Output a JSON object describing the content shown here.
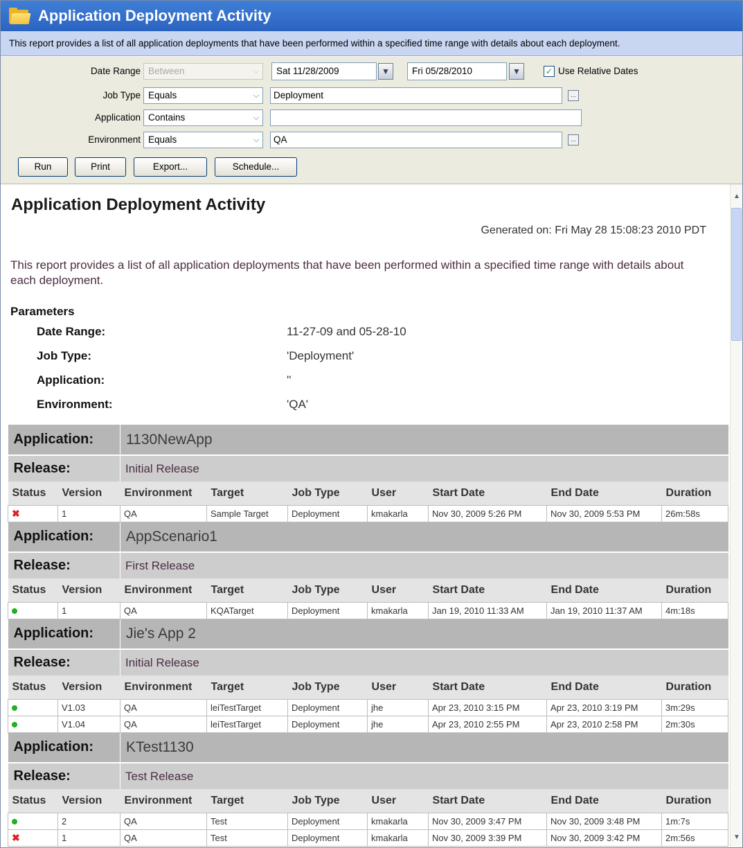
{
  "window": {
    "title": "Application Deployment Activity"
  },
  "description": "This report provides a list of all application deployments that have been performed within a specified time range with details about each deployment.",
  "filters": {
    "date_range": {
      "label": "Date Range",
      "operator": "Between",
      "from": "Sat 11/28/2009",
      "to": "Fri 05/28/2010",
      "use_relative_dates_label": "Use Relative Dates",
      "use_relative_dates": true
    },
    "job_type": {
      "label": "Job Type",
      "operator": "Equals",
      "value": "Deployment"
    },
    "application": {
      "label": "Application",
      "operator": "Contains",
      "value": ""
    },
    "environment": {
      "label": "Environment",
      "operator": "Equals",
      "value": "QA"
    }
  },
  "buttons": {
    "run": "Run",
    "print": "Print",
    "export": "Export...",
    "schedule": "Schedule..."
  },
  "report": {
    "title": "Application Deployment Activity",
    "generated": "Generated on: Fri May 28 15:08:23 2010 PDT",
    "description": "This report provides a list of all application deployments that have been performed within a specified time range with details about each deployment.",
    "parameters_heading": "Parameters",
    "parameters": [
      {
        "name": "Date Range:",
        "value": "11-27-09 and 05-28-10"
      },
      {
        "name": "Job Type:",
        "value": "'Deployment'"
      },
      {
        "name": "Application:",
        "value": "''"
      },
      {
        "name": "Environment:",
        "value": "'QA'"
      }
    ],
    "application_label": "Application:",
    "release_label": "Release:",
    "columns": [
      "Status",
      "Version",
      "Environment",
      "Target",
      "Job Type",
      "User",
      "Start Date",
      "End Date",
      "Duration"
    ],
    "applications": [
      {
        "name": "1130NewApp",
        "release": "Initial Release",
        "rows": [
          {
            "status": "fail",
            "version": "1",
            "environment": "QA",
            "target": "Sample Target",
            "job_type": "Deployment",
            "user": "kmakarla",
            "start": "Nov 30, 2009 5:26 PM",
            "end": "Nov 30, 2009 5:53 PM",
            "duration": "26m:58s"
          }
        ]
      },
      {
        "name": "AppScenario1",
        "release": "First Release",
        "rows": [
          {
            "status": "success",
            "version": "1",
            "environment": "QA",
            "target": "KQATarget",
            "job_type": "Deployment",
            "user": "kmakarla",
            "start": "Jan 19, 2010 11:33 AM",
            "end": "Jan 19, 2010 11:37 AM",
            "duration": "4m:18s"
          }
        ]
      },
      {
        "name": "Jie's App 2",
        "release": "Initial Release",
        "rows": [
          {
            "status": "success",
            "version": "V1.03",
            "environment": "QA",
            "target": "leiTestTarget",
            "job_type": "Deployment",
            "user": "jhe",
            "start": "Apr 23, 2010 3:15 PM",
            "end": "Apr 23, 2010 3:19 PM",
            "duration": "3m:29s"
          },
          {
            "status": "success",
            "version": "V1.04",
            "environment": "QA",
            "target": "leiTestTarget",
            "job_type": "Deployment",
            "user": "jhe",
            "start": "Apr 23, 2010 2:55 PM",
            "end": "Apr 23, 2010 2:58 PM",
            "duration": "2m:30s"
          }
        ]
      },
      {
        "name": "KTest1130",
        "release": "Test Release",
        "rows": [
          {
            "status": "success",
            "version": "2",
            "environment": "QA",
            "target": "Test",
            "job_type": "Deployment",
            "user": "kmakarla",
            "start": "Nov 30, 2009 3:47 PM",
            "end": "Nov 30, 2009 3:48 PM",
            "duration": "1m:7s"
          },
          {
            "status": "fail",
            "version": "1",
            "environment": "QA",
            "target": "Test",
            "job_type": "Deployment",
            "user": "kmakarla",
            "start": "Nov 30, 2009 3:39 PM",
            "end": "Nov 30, 2009 3:42 PM",
            "duration": "2m:56s"
          }
        ]
      }
    ]
  },
  "icons": {
    "title": "folder-icon",
    "fail": "red-x-icon",
    "success": "green-dot-icon"
  },
  "colors": {
    "title_bar": "#2f6fce",
    "desc_bar": "#c8d6f1",
    "param_panel": "#ecebe0",
    "fail": "#e02020",
    "success": "#22b022"
  }
}
